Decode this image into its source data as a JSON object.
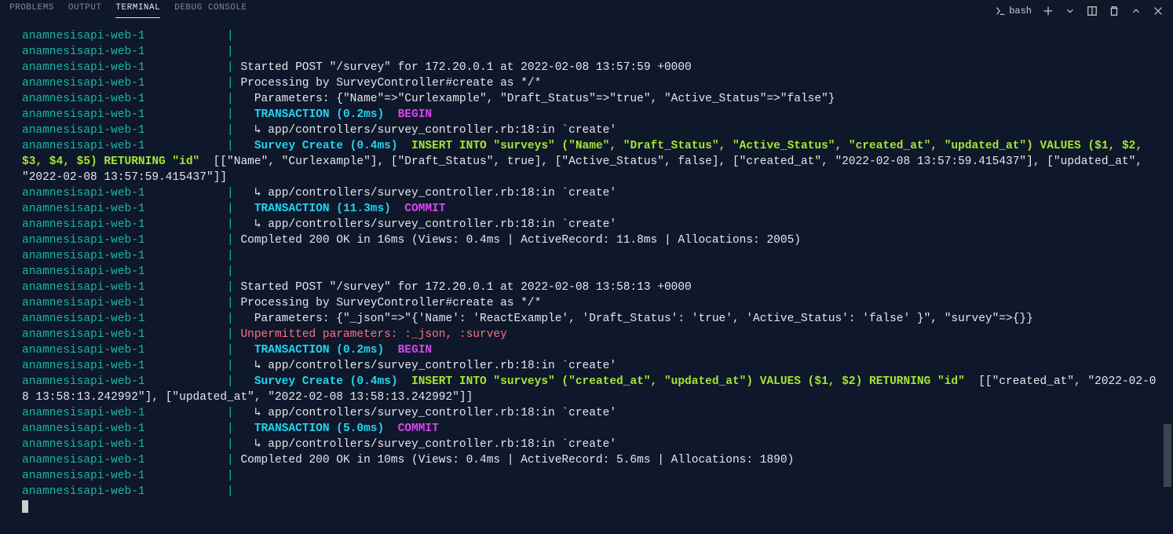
{
  "tabs": {
    "problems": "PROBLEMS",
    "output": "OUTPUT",
    "terminal": "TERMINAL",
    "debug": "DEBUG CONSOLE"
  },
  "shell": "bash",
  "prefix": "anamnesisapi-web-1",
  "lines": [
    {
      "t": "prefix"
    },
    {
      "t": "prefix"
    },
    {
      "t": "plain",
      "txt": "Started POST \"/survey\" for 172.20.0.1 at 2022-02-08 13:57:59 +0000"
    },
    {
      "t": "plain",
      "txt": "Processing by SurveyController#create as */*"
    },
    {
      "t": "plain",
      "txt": "  Parameters: {\"Name\"=>\"Curlexample\", \"Draft_Status\"=>\"true\", \"Active_Status\"=>\"false\"}"
    },
    {
      "t": "tx",
      "label": "TRANSACTION",
      "time": "(0.2ms)",
      "cmd": "BEGIN"
    },
    {
      "t": "plain",
      "txt": "  ↳ app/controllers/survey_controller.rb:18:in `create'"
    },
    {
      "t": "sql1"
    },
    {
      "t": "plain",
      "txt": "  ↳ app/controllers/survey_controller.rb:18:in `create'"
    },
    {
      "t": "tx",
      "label": "TRANSACTION",
      "time": "(11.3ms)",
      "cmd": "COMMIT"
    },
    {
      "t": "plain",
      "txt": "  ↳ app/controllers/survey_controller.rb:18:in `create'"
    },
    {
      "t": "plain",
      "txt": "Completed 200 OK in 16ms (Views: 0.4ms | ActiveRecord: 11.8ms | Allocations: 2005)"
    },
    {
      "t": "prefix"
    },
    {
      "t": "prefix"
    },
    {
      "t": "plain",
      "txt": "Started POST \"/survey\" for 172.20.0.1 at 2022-02-08 13:58:13 +0000"
    },
    {
      "t": "plain",
      "txt": "Processing by SurveyController#create as */*"
    },
    {
      "t": "plain",
      "txt": "  Parameters: {\"_json\"=>\"{'Name': 'ReactExample', 'Draft_Status': 'true', 'Active_Status': 'false' }\", \"survey\"=>{}}"
    },
    {
      "t": "red",
      "txt": "Unpermitted parameters: :_json, :survey"
    },
    {
      "t": "tx",
      "label": "TRANSACTION",
      "time": "(0.2ms)",
      "cmd": "BEGIN"
    },
    {
      "t": "plain",
      "txt": "  ↳ app/controllers/survey_controller.rb:18:in `create'"
    },
    {
      "t": "sql2"
    },
    {
      "t": "plain",
      "txt": "  ↳ app/controllers/survey_controller.rb:18:in `create'"
    },
    {
      "t": "tx",
      "label": "TRANSACTION",
      "time": "(5.0ms)",
      "cmd": "COMMIT"
    },
    {
      "t": "plain",
      "txt": "  ↳ app/controllers/survey_controller.rb:18:in `create'"
    },
    {
      "t": "plain",
      "txt": "Completed 200 OK in 10ms (Views: 0.4ms | ActiveRecord: 5.6ms | Allocations: 1890)"
    },
    {
      "t": "prefix"
    },
    {
      "t": "prefix"
    }
  ],
  "sql1": {
    "label": "Survey Create",
    "time": "(0.4ms)",
    "query": "INSERT INTO \"surveys\" (\"Name\", \"Draft_Status\", \"Active_Status\", \"created_at\", \"updated_at\") VALUES ($1, $2, $3, $4, $5) RETURNING \"id\"",
    "params": "  [[\"Name\", \"Curlexample\"], [\"Draft_Status\", true], [\"Active_Status\", false], [\"created_at\", \"2022-02-08 13:57:59.415437\"], [\"updated_at\", \"2022-02-08 13:57:59.415437\"]]"
  },
  "sql2": {
    "label": "Survey Create",
    "time": "(0.4ms)",
    "query": "INSERT INTO \"surveys\" (\"created_at\", \"updated_at\") VALUES ($1, $2) RETURNING \"id\"",
    "params": "  [[\"created_at\", \"2022-02-08 13:58:13.242992\"], [\"updated_at\", \"2022-02-08 13:58:13.242992\"]]"
  }
}
